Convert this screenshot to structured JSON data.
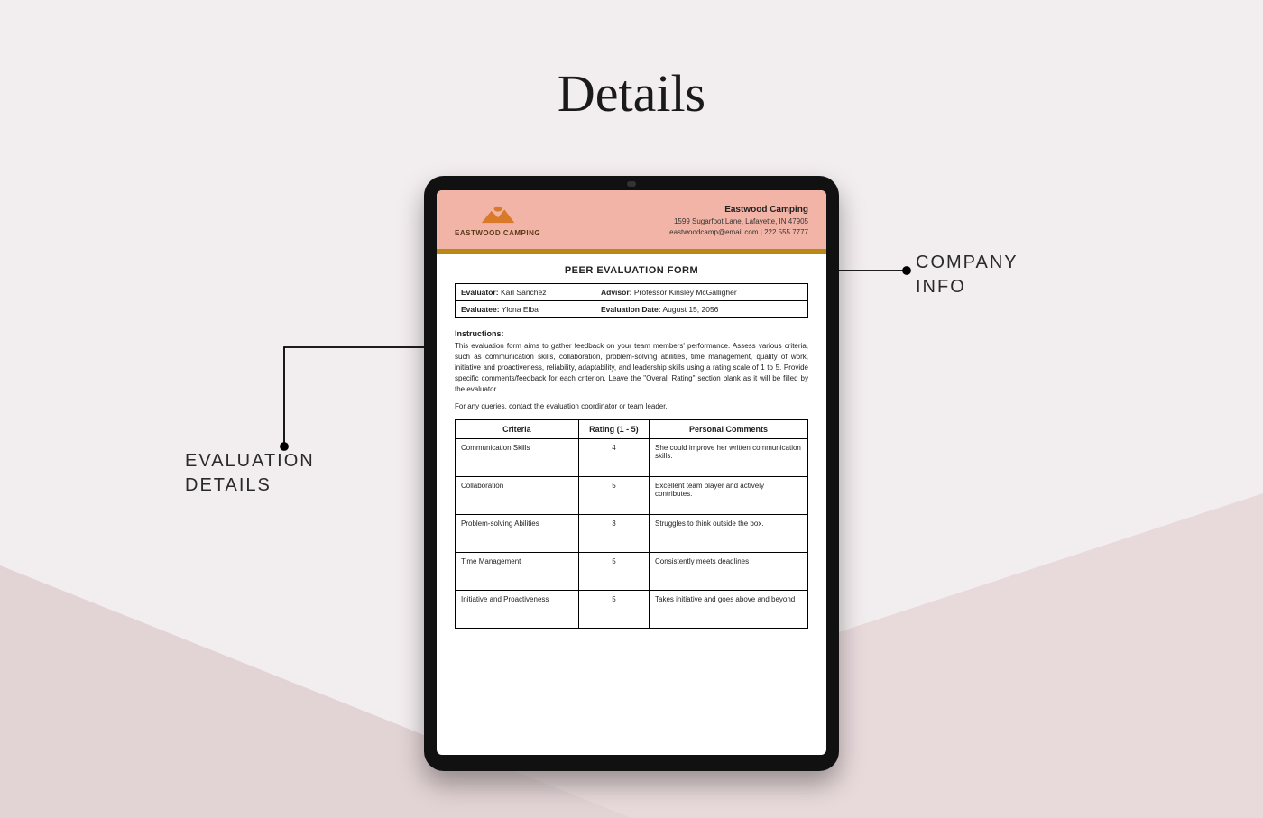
{
  "page": {
    "title": "Details"
  },
  "annotations": {
    "company_info": "COMPANY\nINFO",
    "evaluation_details": "EVALUATION\nDETAILS"
  },
  "company": {
    "logo_text": "EASTWOOD CAMPING",
    "name": "Eastwood Camping",
    "address": "1599 Sugarfoot Lane, Lafayette, IN 47905",
    "contact": "eastwoodcamp@email.com | 222 555 7777"
  },
  "document": {
    "title": "PEER EVALUATION FORM",
    "meta": {
      "evaluator_label": "Evaluator:",
      "evaluator_value": "Karl Sanchez",
      "advisor_label": "Advisor:",
      "advisor_value": "Professor Kinsley McGalligher",
      "evaluatee_label": "Evaluatee:",
      "evaluatee_value": "Ylona Elba",
      "date_label": "Evaluation Date:",
      "date_value": "August 15, 2056"
    },
    "instructions_heading": "Instructions:",
    "instructions_text": "This evaluation form aims to gather feedback on your team members' performance. Assess various criteria, such as communication skills, collaboration, problem-solving abilities, time management, quality of work, initiative and proactiveness, reliability, adaptability, and leadership skills using a rating scale of 1 to 5. Provide specific comments/feedback for each criterion. Leave the \"Overall Rating\" section blank as it will be filled by the evaluator.",
    "instructions_note": "For any queries, contact the evaluation coordinator or team leader.",
    "table_headers": {
      "criteria": "Criteria",
      "rating": "Rating (1 - 5)",
      "comments": "Personal Comments"
    },
    "rows": [
      {
        "criteria": "Communication Skills",
        "rating": "4",
        "comments": "She could improve her written communication skills."
      },
      {
        "criteria": "Collaboration",
        "rating": "5",
        "comments": "Excellent team player and actively contributes."
      },
      {
        "criteria": "Problem-solving Abilities",
        "rating": "3",
        "comments": "Struggles to think outside the box."
      },
      {
        "criteria": "Time Management",
        "rating": "5",
        "comments": "Consistently meets deadlines"
      },
      {
        "criteria": "Initiative and Proactiveness",
        "rating": "5",
        "comments": "Takes initiative and goes above and beyond"
      }
    ]
  }
}
